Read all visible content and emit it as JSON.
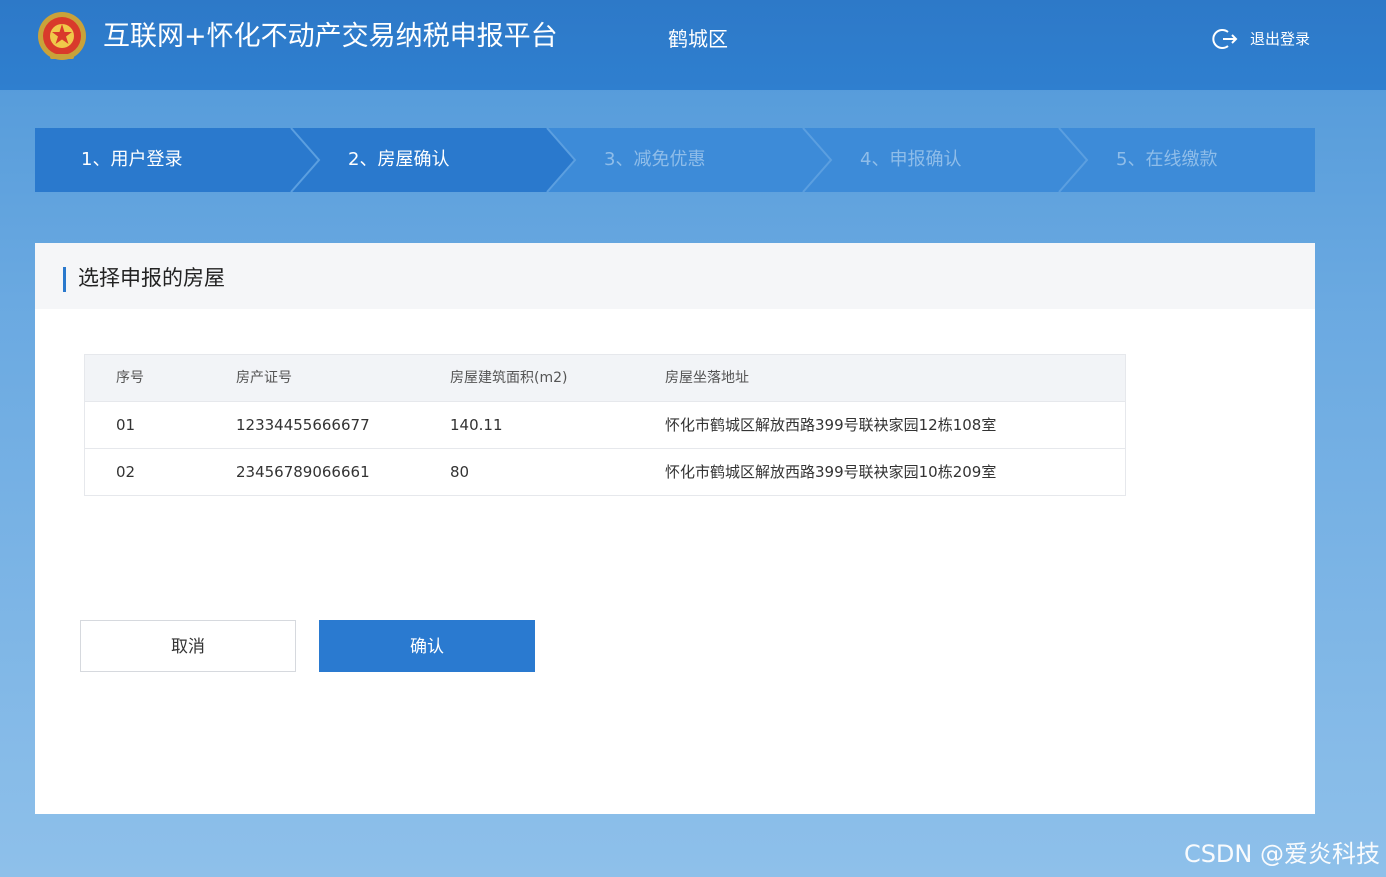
{
  "header": {
    "app_title": "互联网+怀化不动产交易纳税申报平台",
    "district": "鹤城区",
    "logout_label": "退出登录"
  },
  "steps": [
    {
      "label": "1、用户登录",
      "state": "done"
    },
    {
      "label": "2、房屋确认",
      "state": "active"
    },
    {
      "label": "3、减免优惠",
      "state": "pending"
    },
    {
      "label": "4、申报确认",
      "state": "pending"
    },
    {
      "label": "5、在线缴款",
      "state": "pending"
    }
  ],
  "section": {
    "title": "选择申报的房屋"
  },
  "table": {
    "columns": [
      "序号",
      "房产证号",
      "房屋建筑面积(m2)",
      "房屋坐落地址"
    ],
    "rows": [
      [
        "01",
        "12334455666677",
        "140.11",
        "怀化市鹤城区解放西路399号联袂家园12栋108室"
      ],
      [
        "02",
        "23456789066661",
        "80",
        "怀化市鹤城区解放西路399号联袂家园10栋209室"
      ]
    ]
  },
  "buttons": {
    "cancel": "取消",
    "confirm": "确认"
  },
  "watermark": "CSDN @爱炎科技",
  "colors": {
    "header_bg": "#2f7fcf",
    "accent": "#2a79cd",
    "step_done_text": "#ffffff",
    "step_pending_text": "#8fbde9"
  }
}
